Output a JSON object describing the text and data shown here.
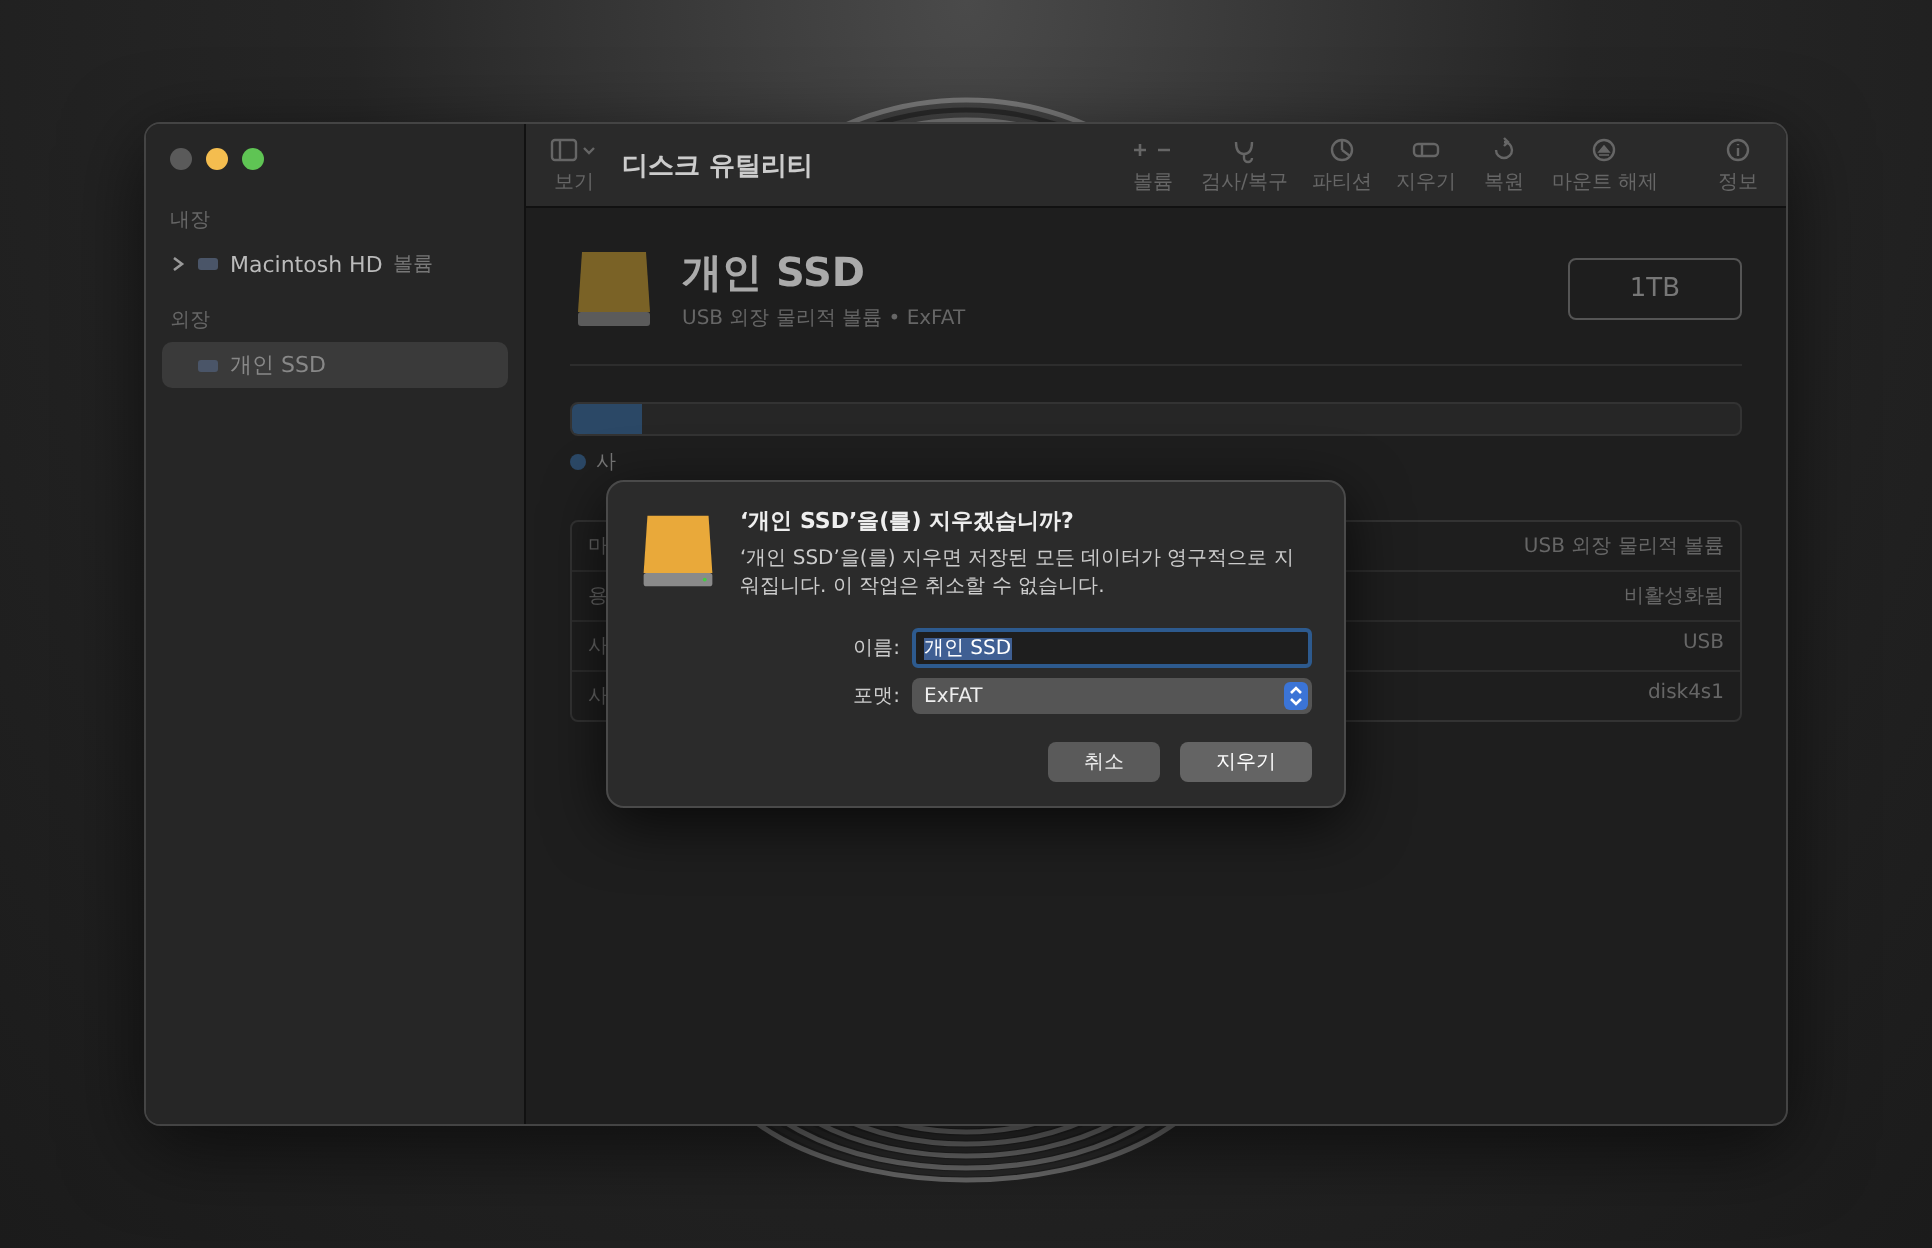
{
  "sidebar": {
    "sections": [
      {
        "header": "내장",
        "items": [
          {
            "name": "Macintosh HD",
            "suffix": "볼륨",
            "expanded": false,
            "selected": false
          }
        ]
      },
      {
        "header": "외장",
        "items": [
          {
            "name": "개인 SSD",
            "selected": true
          }
        ]
      }
    ]
  },
  "toolbar": {
    "view_label": "보기",
    "title": "디스크 유틸리티",
    "buttons": [
      {
        "kind": "volume",
        "label": "볼륨"
      },
      {
        "kind": "firstaid",
        "label": "검사/복구"
      },
      {
        "kind": "partition",
        "label": "파티션"
      },
      {
        "kind": "erase",
        "label": "지우기"
      },
      {
        "kind": "restore",
        "label": "복원"
      },
      {
        "kind": "unmount",
        "label": "마운트 해제"
      },
      {
        "kind": "info",
        "label": "정보"
      }
    ]
  },
  "disk": {
    "name": "개인 SSD",
    "subtitle": "USB 외장 물리적 볼륨 • ExFAT",
    "capacity": "1TB",
    "usage": {
      "level": 0.06
    },
    "legend": "사"
  },
  "info_rows": [
    {
      "label": "마",
      "value": "USB 외장 물리적 볼륨"
    },
    {
      "label": "용",
      "value": "비활성화됨"
    },
    {
      "label": "사",
      "value": "USB"
    },
    {
      "label": "사",
      "value": "disk4s1"
    }
  ],
  "dialog": {
    "title": "‘개인 SSD’을(를) 지우겠습니까?",
    "message": "‘개인 SSD’을(를) 지우면 저장된 모든 데이터가 영구적으로 지워집니다. 이 작업은 취소할 수 없습니다.",
    "name_label": "이름:",
    "name_value": "개인 SSD",
    "format_label": "포맷:",
    "format_value": "ExFAT",
    "buttons": [
      {
        "kind": "cancel",
        "label": "취소"
      },
      {
        "kind": "confirm",
        "label": "지우기"
      }
    ]
  }
}
